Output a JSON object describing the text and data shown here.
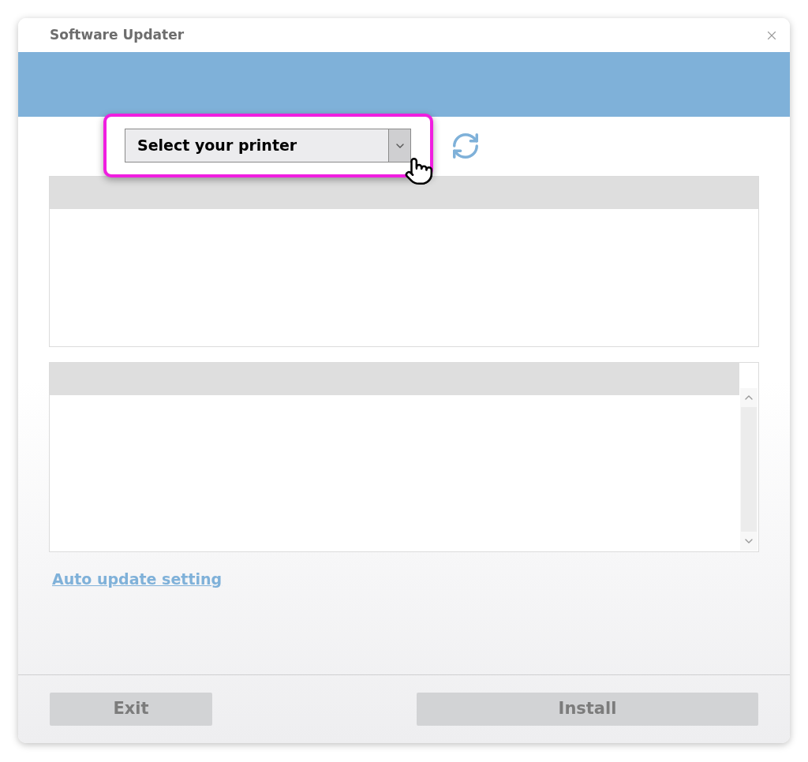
{
  "window": {
    "title": "Software Updater"
  },
  "printer_select": {
    "value": "Select your printer",
    "highlighted": true
  },
  "link": {
    "label": "Auto update setting"
  },
  "buttons": [
    {
      "label": "Exit",
      "disabled": true
    },
    {
      "label": "Install",
      "disabled": true
    }
  ]
}
